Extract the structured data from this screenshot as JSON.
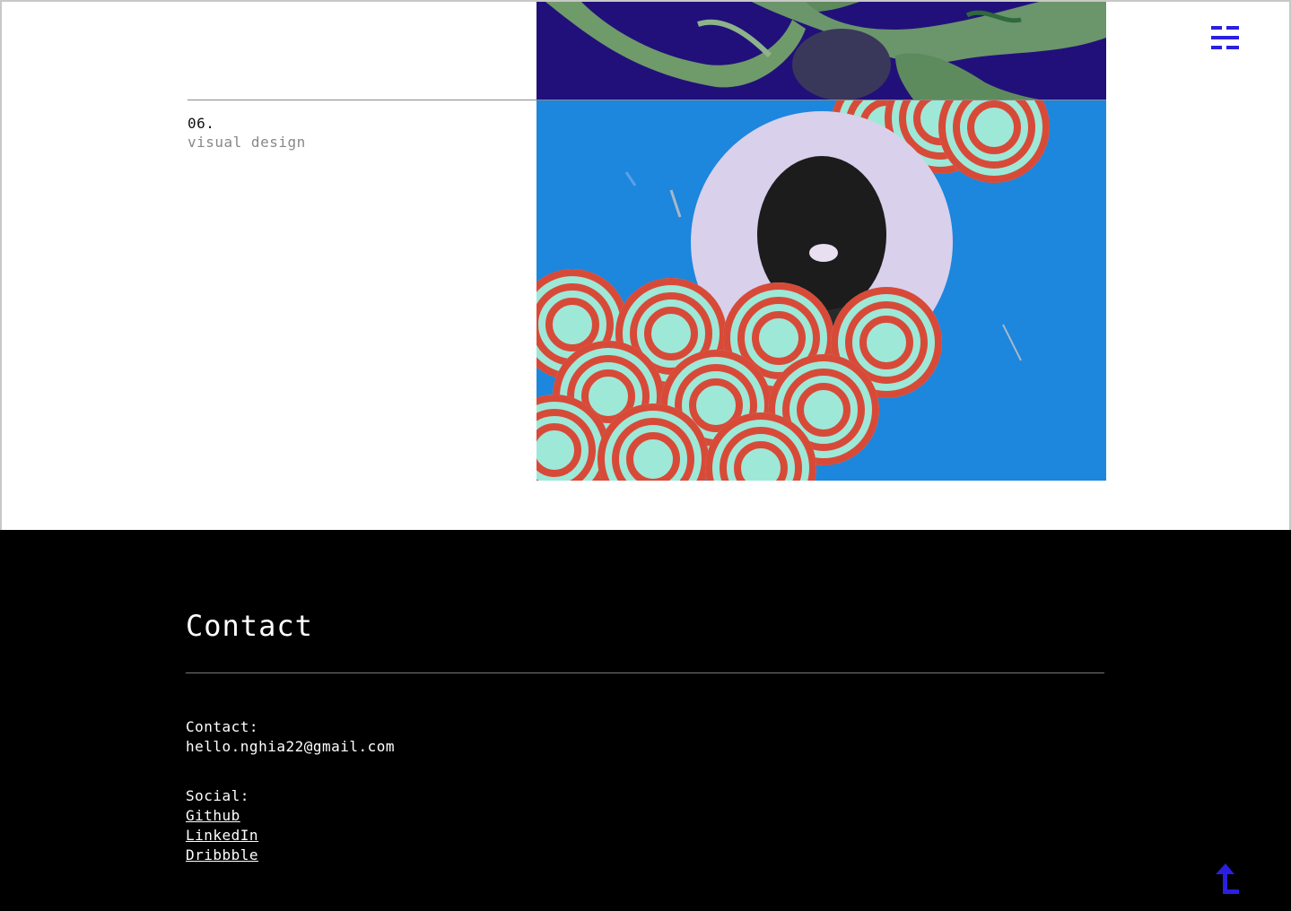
{
  "project": {
    "number": "06.",
    "title": "visual design"
  },
  "contact": {
    "heading": "Contact",
    "contact_label": "Contact:",
    "email": "hello.nghia22@gmail.com",
    "social_label": "Social:",
    "links": [
      "Github",
      "LinkedIn",
      "Dribbble"
    ]
  },
  "icons": {
    "menu": "menu-icon",
    "back_to_top": "arrow-up-icon"
  },
  "colors": {
    "accent": "#2a1fe0",
    "footer_bg": "#000000",
    "muted_text": "#888888",
    "image_blue": "#1d86dd",
    "image_rings": "#d84a38",
    "image_mint": "#9ee8d8"
  }
}
